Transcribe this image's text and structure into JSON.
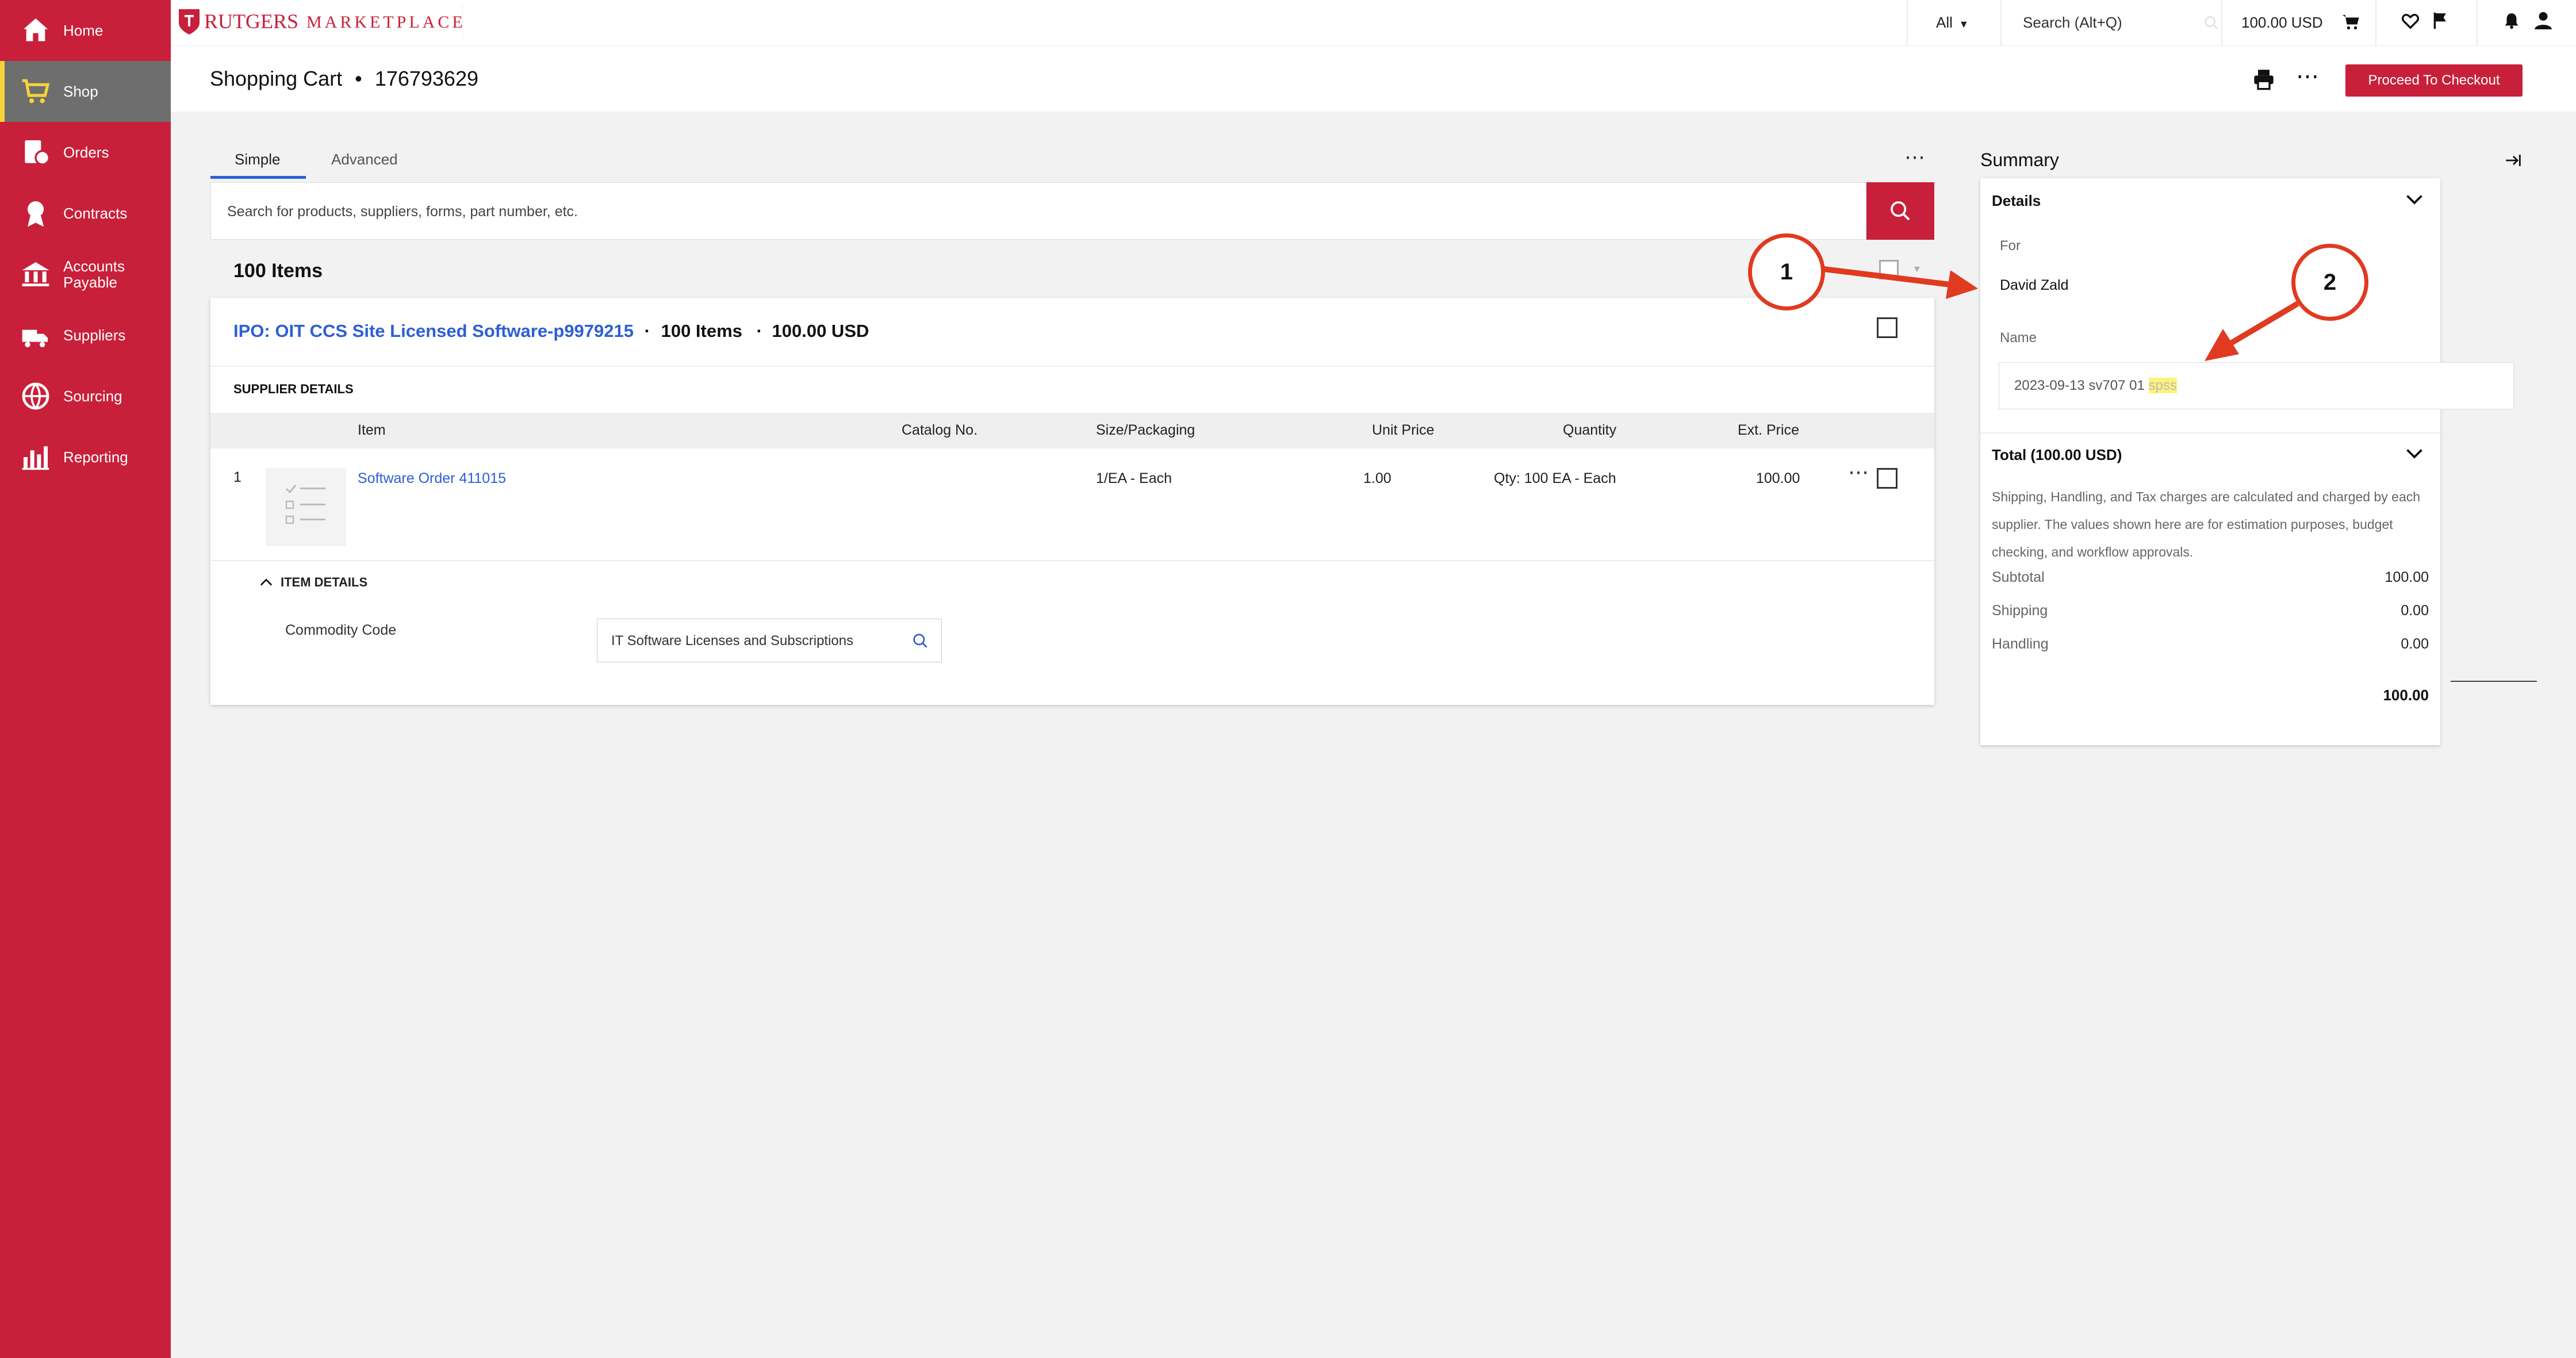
{
  "nav": {
    "items": [
      {
        "label": "Home"
      },
      {
        "label": "Shop"
      },
      {
        "label": "Orders"
      },
      {
        "label": "Contracts"
      },
      {
        "label": "Accounts Payable"
      },
      {
        "label": "Suppliers"
      },
      {
        "label": "Sourcing"
      },
      {
        "label": "Reporting"
      }
    ]
  },
  "topbar": {
    "logo_main": "RUTGERS",
    "logo_sub": "MARKETPLACE",
    "scope_select": "All",
    "search_placeholder": "Search (Alt+Q)",
    "cart_total": "100.00 USD",
    "icons": [
      "cart-icon",
      "heart-icon",
      "flag-icon",
      "bell-icon",
      "user-icon"
    ]
  },
  "header": {
    "title": "Shopping Cart",
    "cart_number": "176793629",
    "checkout_label": "Proceed To Checkout"
  },
  "tabs": [
    {
      "label": "Simple"
    },
    {
      "label": "Advanced"
    }
  ],
  "search": {
    "placeholder": "Search for products, suppliers, forms, part number, etc."
  },
  "cart": {
    "items_count": "100 Items",
    "supplier": {
      "name": "IPO: OIT CCS Site Licensed Software-p9979215",
      "items": "100 Items",
      "total": "100.00 USD",
      "details_label": "SUPPLIER DETAILS"
    },
    "columns": [
      "Item",
      "Catalog No.",
      "Size/Packaging",
      "Unit Price",
      "Quantity",
      "Ext. Price"
    ],
    "lines": [
      {
        "index": "1",
        "name": "Software Order 411015",
        "catalog": "",
        "size": "1/EA - Each",
        "unit_price": "1.00",
        "quantity": "Qty: 100 EA - Each",
        "ext_price": "100.00"
      }
    ],
    "item_details": {
      "label": "ITEM DETAILS",
      "commodity_label": "Commodity Code",
      "commodity_value": "IT Software Licenses and Subscriptions"
    }
  },
  "summary": {
    "title": "Summary",
    "details_label": "Details",
    "for_label": "For",
    "for_value": "David Zald",
    "name_label": "Name",
    "name_value_prefix": "2023-09-13 sv707 01 ",
    "name_value_highlight": "spss",
    "total_label": "Total (100.00 USD)",
    "note": "Shipping, Handling, and Tax charges are calculated and charged by each supplier. The values shown here are for estimation purposes, budget checking, and workflow approvals.",
    "rows": [
      {
        "label": "Subtotal",
        "value": "100.00"
      },
      {
        "label": "Shipping",
        "value": "0.00"
      },
      {
        "label": "Handling",
        "value": "0.00"
      }
    ],
    "grand_total": "100.00"
  },
  "annotations": [
    {
      "label": "1"
    },
    {
      "label": "2"
    }
  ],
  "colors": {
    "brand": "#c8203a",
    "link": "#2d5fd4",
    "annotation": "#e03a20",
    "highlight": "#fff27a"
  }
}
